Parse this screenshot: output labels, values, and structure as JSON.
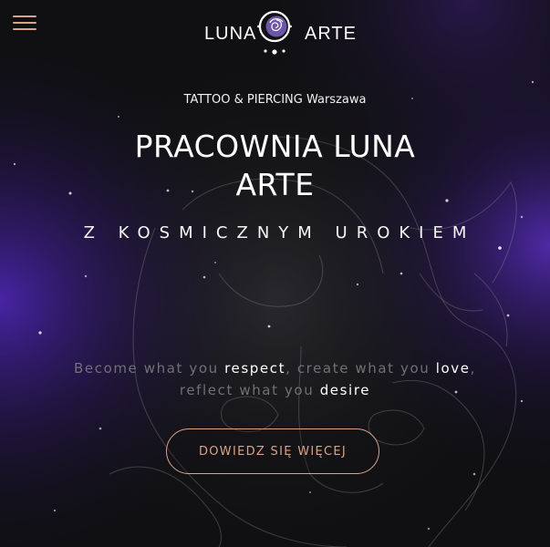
{
  "header": {
    "logo_left": "LUNA",
    "logo_right": "ARTE"
  },
  "hero": {
    "kicker": "TATTOO & PIERCING Warszawa",
    "title_line1": "PRACOWNIA LUNA",
    "title_line2": "ARTE",
    "subtitle": "Z KOSMICZNYM UROKIEM",
    "motto": {
      "p1": "Become what you ",
      "h1": "respect",
      "p2": ", create what you ",
      "h2": "love",
      "p3": ",",
      "p4": "reflect what you ",
      "h3": "desire"
    },
    "cta_label": "DOWIEDZ SIĘ WIĘCEJ"
  },
  "colors": {
    "background": "#101012",
    "accent": "#d9a48a",
    "glow": "#5a2bd6"
  },
  "icons": {
    "menu": "hamburger-menu-icon",
    "logo_mark": "moon-rose-icon"
  }
}
